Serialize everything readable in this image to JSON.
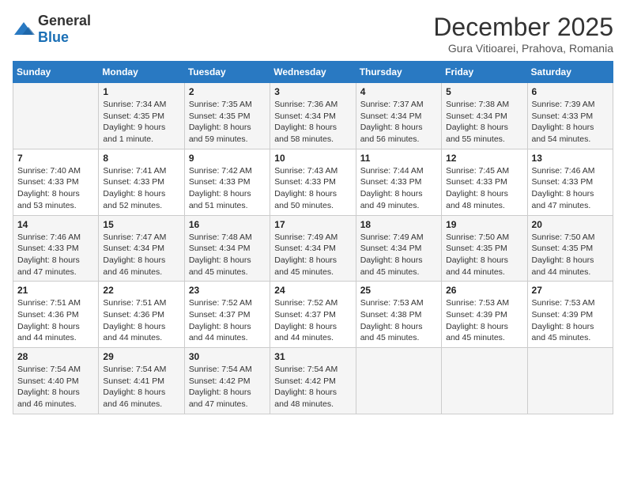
{
  "logo": {
    "general": "General",
    "blue": "Blue"
  },
  "header": {
    "month": "December 2025",
    "location": "Gura Vitioarei, Prahova, Romania"
  },
  "weekdays": [
    "Sunday",
    "Monday",
    "Tuesday",
    "Wednesday",
    "Thursday",
    "Friday",
    "Saturday"
  ],
  "weeks": [
    [
      {
        "day": "",
        "sunrise": "",
        "sunset": "",
        "daylight": ""
      },
      {
        "day": "1",
        "sunrise": "Sunrise: 7:34 AM",
        "sunset": "Sunset: 4:35 PM",
        "daylight": "Daylight: 9 hours and 1 minute."
      },
      {
        "day": "2",
        "sunrise": "Sunrise: 7:35 AM",
        "sunset": "Sunset: 4:35 PM",
        "daylight": "Daylight: 8 hours and 59 minutes."
      },
      {
        "day": "3",
        "sunrise": "Sunrise: 7:36 AM",
        "sunset": "Sunset: 4:34 PM",
        "daylight": "Daylight: 8 hours and 58 minutes."
      },
      {
        "day": "4",
        "sunrise": "Sunrise: 7:37 AM",
        "sunset": "Sunset: 4:34 PM",
        "daylight": "Daylight: 8 hours and 56 minutes."
      },
      {
        "day": "5",
        "sunrise": "Sunrise: 7:38 AM",
        "sunset": "Sunset: 4:34 PM",
        "daylight": "Daylight: 8 hours and 55 minutes."
      },
      {
        "day": "6",
        "sunrise": "Sunrise: 7:39 AM",
        "sunset": "Sunset: 4:33 PM",
        "daylight": "Daylight: 8 hours and 54 minutes."
      }
    ],
    [
      {
        "day": "7",
        "sunrise": "Sunrise: 7:40 AM",
        "sunset": "Sunset: 4:33 PM",
        "daylight": "Daylight: 8 hours and 53 minutes."
      },
      {
        "day": "8",
        "sunrise": "Sunrise: 7:41 AM",
        "sunset": "Sunset: 4:33 PM",
        "daylight": "Daylight: 8 hours and 52 minutes."
      },
      {
        "day": "9",
        "sunrise": "Sunrise: 7:42 AM",
        "sunset": "Sunset: 4:33 PM",
        "daylight": "Daylight: 8 hours and 51 minutes."
      },
      {
        "day": "10",
        "sunrise": "Sunrise: 7:43 AM",
        "sunset": "Sunset: 4:33 PM",
        "daylight": "Daylight: 8 hours and 50 minutes."
      },
      {
        "day": "11",
        "sunrise": "Sunrise: 7:44 AM",
        "sunset": "Sunset: 4:33 PM",
        "daylight": "Daylight: 8 hours and 49 minutes."
      },
      {
        "day": "12",
        "sunrise": "Sunrise: 7:45 AM",
        "sunset": "Sunset: 4:33 PM",
        "daylight": "Daylight: 8 hours and 48 minutes."
      },
      {
        "day": "13",
        "sunrise": "Sunrise: 7:46 AM",
        "sunset": "Sunset: 4:33 PM",
        "daylight": "Daylight: 8 hours and 47 minutes."
      }
    ],
    [
      {
        "day": "14",
        "sunrise": "Sunrise: 7:46 AM",
        "sunset": "Sunset: 4:33 PM",
        "daylight": "Daylight: 8 hours and 47 minutes."
      },
      {
        "day": "15",
        "sunrise": "Sunrise: 7:47 AM",
        "sunset": "Sunset: 4:34 PM",
        "daylight": "Daylight: 8 hours and 46 minutes."
      },
      {
        "day": "16",
        "sunrise": "Sunrise: 7:48 AM",
        "sunset": "Sunset: 4:34 PM",
        "daylight": "Daylight: 8 hours and 45 minutes."
      },
      {
        "day": "17",
        "sunrise": "Sunrise: 7:49 AM",
        "sunset": "Sunset: 4:34 PM",
        "daylight": "Daylight: 8 hours and 45 minutes."
      },
      {
        "day": "18",
        "sunrise": "Sunrise: 7:49 AM",
        "sunset": "Sunset: 4:34 PM",
        "daylight": "Daylight: 8 hours and 45 minutes."
      },
      {
        "day": "19",
        "sunrise": "Sunrise: 7:50 AM",
        "sunset": "Sunset: 4:35 PM",
        "daylight": "Daylight: 8 hours and 44 minutes."
      },
      {
        "day": "20",
        "sunrise": "Sunrise: 7:50 AM",
        "sunset": "Sunset: 4:35 PM",
        "daylight": "Daylight: 8 hours and 44 minutes."
      }
    ],
    [
      {
        "day": "21",
        "sunrise": "Sunrise: 7:51 AM",
        "sunset": "Sunset: 4:36 PM",
        "daylight": "Daylight: 8 hours and 44 minutes."
      },
      {
        "day": "22",
        "sunrise": "Sunrise: 7:51 AM",
        "sunset": "Sunset: 4:36 PM",
        "daylight": "Daylight: 8 hours and 44 minutes."
      },
      {
        "day": "23",
        "sunrise": "Sunrise: 7:52 AM",
        "sunset": "Sunset: 4:37 PM",
        "daylight": "Daylight: 8 hours and 44 minutes."
      },
      {
        "day": "24",
        "sunrise": "Sunrise: 7:52 AM",
        "sunset": "Sunset: 4:37 PM",
        "daylight": "Daylight: 8 hours and 44 minutes."
      },
      {
        "day": "25",
        "sunrise": "Sunrise: 7:53 AM",
        "sunset": "Sunset: 4:38 PM",
        "daylight": "Daylight: 8 hours and 45 minutes."
      },
      {
        "day": "26",
        "sunrise": "Sunrise: 7:53 AM",
        "sunset": "Sunset: 4:39 PM",
        "daylight": "Daylight: 8 hours and 45 minutes."
      },
      {
        "day": "27",
        "sunrise": "Sunrise: 7:53 AM",
        "sunset": "Sunset: 4:39 PM",
        "daylight": "Daylight: 8 hours and 45 minutes."
      }
    ],
    [
      {
        "day": "28",
        "sunrise": "Sunrise: 7:54 AM",
        "sunset": "Sunset: 4:40 PM",
        "daylight": "Daylight: 8 hours and 46 minutes."
      },
      {
        "day": "29",
        "sunrise": "Sunrise: 7:54 AM",
        "sunset": "Sunset: 4:41 PM",
        "daylight": "Daylight: 8 hours and 46 minutes."
      },
      {
        "day": "30",
        "sunrise": "Sunrise: 7:54 AM",
        "sunset": "Sunset: 4:42 PM",
        "daylight": "Daylight: 8 hours and 47 minutes."
      },
      {
        "day": "31",
        "sunrise": "Sunrise: 7:54 AM",
        "sunset": "Sunset: 4:42 PM",
        "daylight": "Daylight: 8 hours and 48 minutes."
      },
      {
        "day": "",
        "sunrise": "",
        "sunset": "",
        "daylight": ""
      },
      {
        "day": "",
        "sunrise": "",
        "sunset": "",
        "daylight": ""
      },
      {
        "day": "",
        "sunrise": "",
        "sunset": "",
        "daylight": ""
      }
    ]
  ]
}
